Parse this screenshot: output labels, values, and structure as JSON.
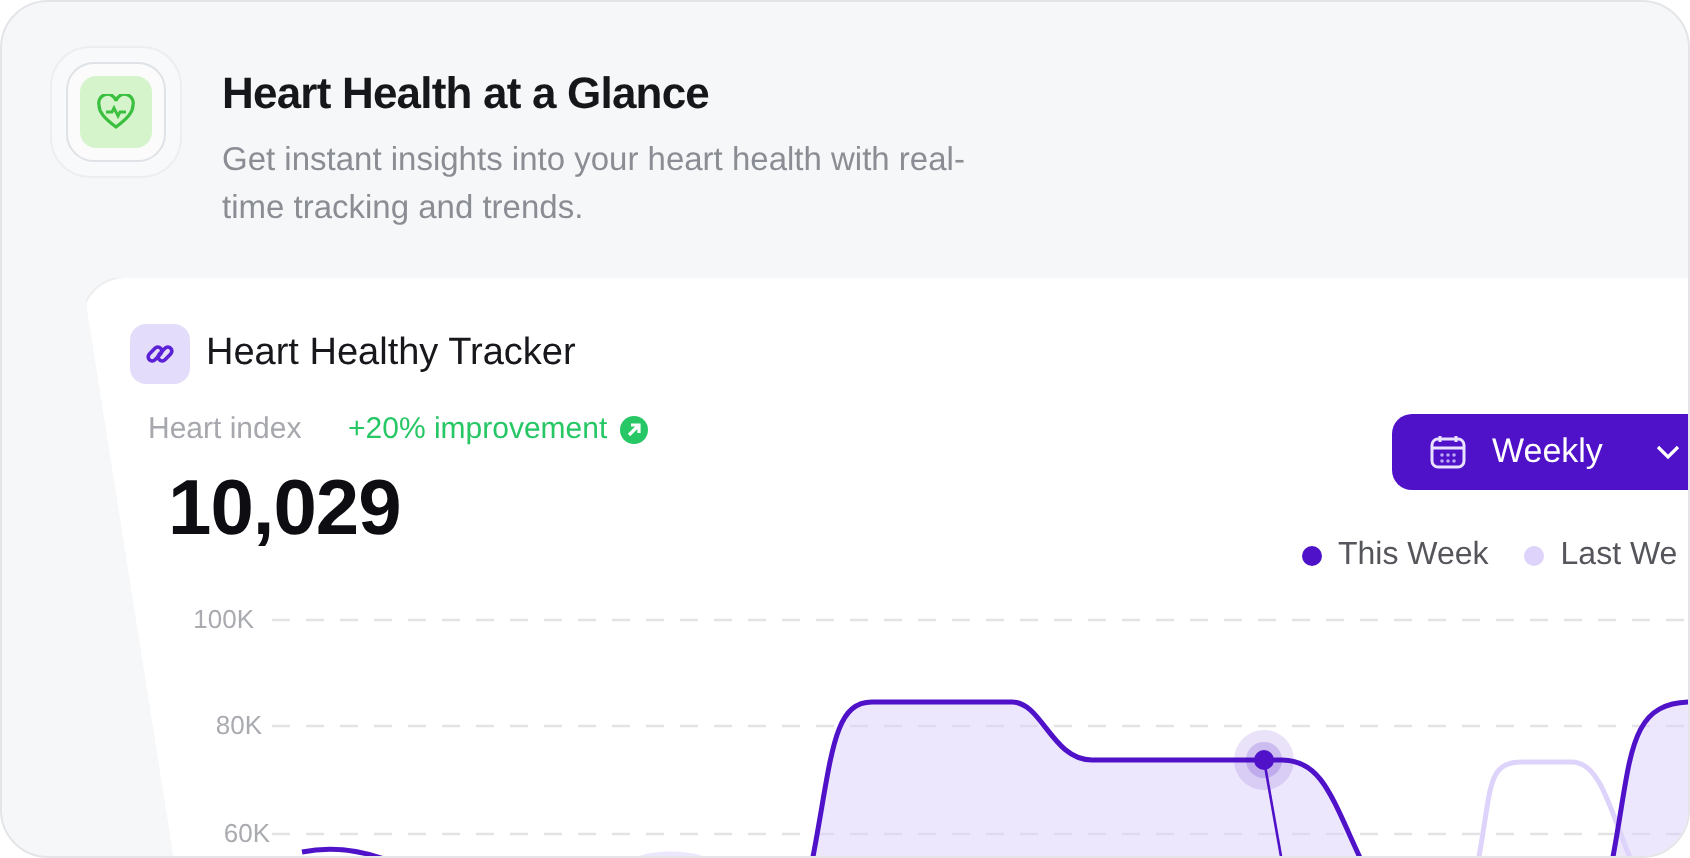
{
  "header": {
    "title": "Heart Health at a Glance",
    "subtitle": "Get instant insights into your heart health with real-time tracking and trends."
  },
  "tracker": {
    "title": "Heart Healthy Tracker",
    "metric_label": "Heart index",
    "change": "+20% improvement",
    "value": "10,029",
    "period_button": "Weekly",
    "legend": [
      {
        "label": "This Week",
        "color": "#4f12c8"
      },
      {
        "label": "Last We",
        "color": "#ddd3fb"
      }
    ],
    "y_axis_labels": [
      "100K",
      "80K",
      "60K"
    ]
  }
}
